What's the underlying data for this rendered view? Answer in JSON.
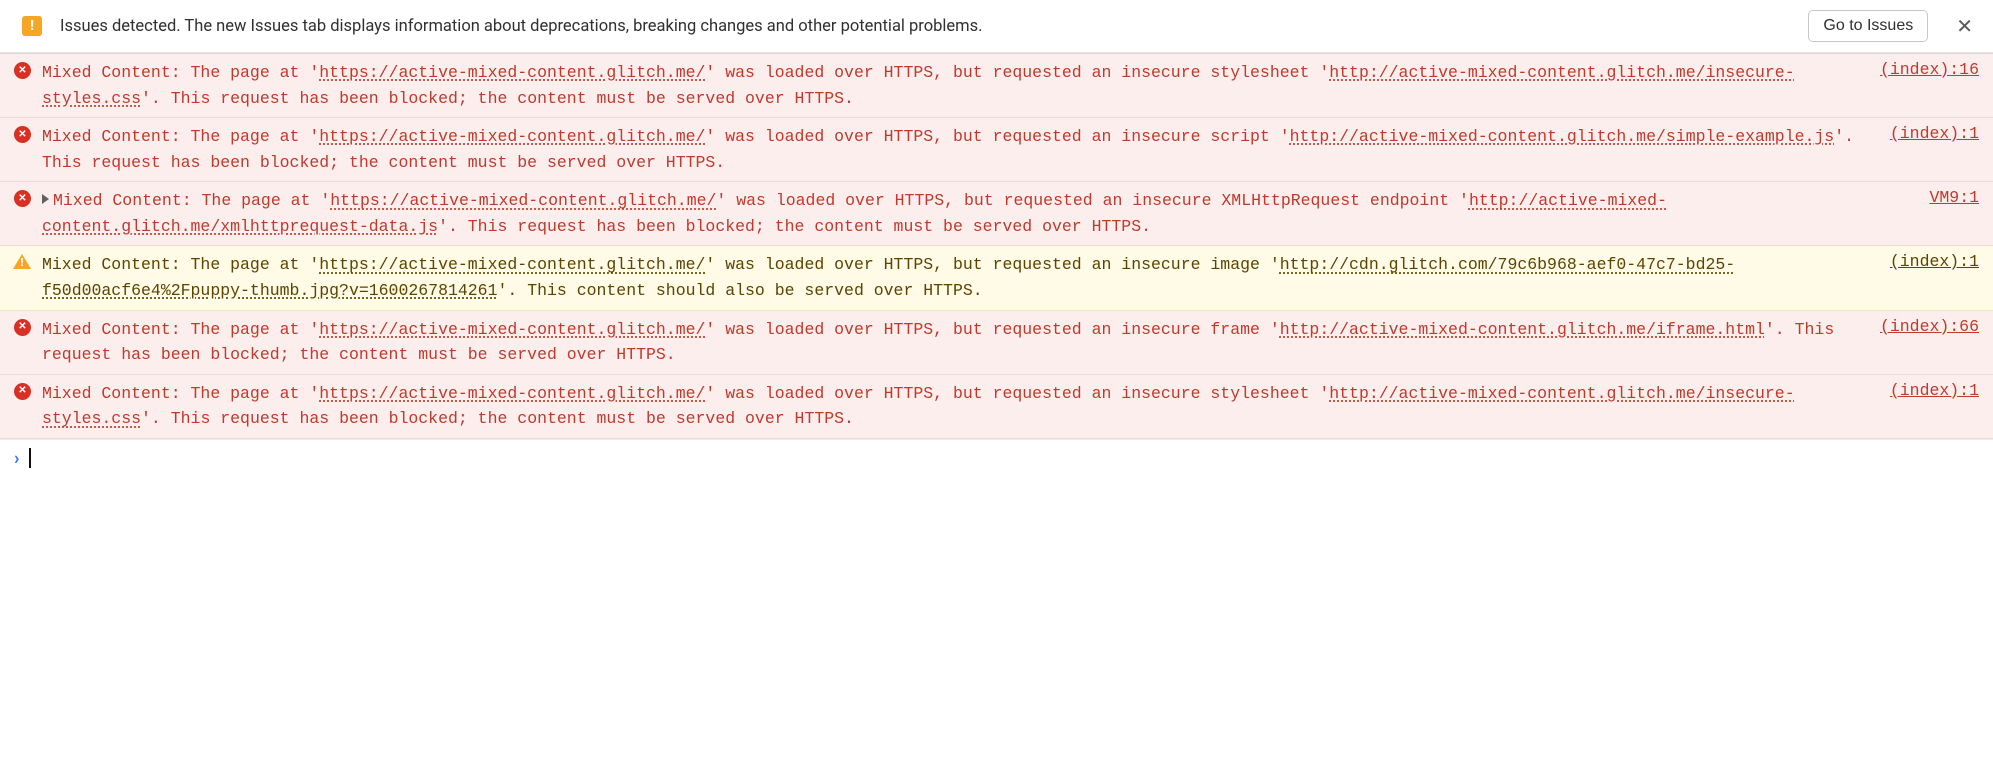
{
  "infobar": {
    "text": "Issues detected. The new Issues tab displays information about deprecations, breaking changes and other potential problems.",
    "button": "Go to Issues"
  },
  "messages": [
    {
      "level": "error",
      "expandable": false,
      "seg1": "Mixed Content: The page at '",
      "url1": "https://active-mixed-content.glitch.me/",
      "seg2": "' was loaded over HTTPS, but requested an insecure stylesheet '",
      "url2": "http://active-mixed-content.glitch.me/insecure-styles.css",
      "seg3": "'. This request has been blocked; the content must be served over HTTPS.",
      "source": "(index):16"
    },
    {
      "level": "error",
      "expandable": false,
      "seg1": "Mixed Content: The page at '",
      "url1": "https://active-mixed-content.glitch.me/",
      "seg2": "' was loaded over HTTPS, but requested an insecure script '",
      "url2": "http://active-mixed-content.glitch.me/simple-example.js",
      "seg3": "'. This request has been blocked; the content must be served over HTTPS.",
      "source": "(index):1"
    },
    {
      "level": "error",
      "expandable": true,
      "seg1": "Mixed Content: The page at '",
      "url1": "https://active-mixed-content.glitch.me/",
      "seg2": "' was loaded over HTTPS, but requested an insecure XMLHttpRequest endpoint '",
      "url2": "http://active-mixed-content.glitch.me/xmlhttprequest-data.js",
      "seg3": "'. This request has been blocked; the content must be served over HTTPS.",
      "source": "VM9:1"
    },
    {
      "level": "warn",
      "expandable": false,
      "seg1": "Mixed Content: The page at '",
      "url1": "https://active-mixed-content.glitch.me/",
      "seg2": "' was loaded over HTTPS, but requested an insecure image '",
      "url2": "http://cdn.glitch.com/79c6b968-aef0-47c7-bd25-f50d00acf6e4%2Fpuppy-thumb.jpg?v=1600267814261",
      "seg3": "'. This content should also be served over HTTPS.",
      "source": "(index):1"
    },
    {
      "level": "error",
      "expandable": false,
      "seg1": "Mixed Content: The page at '",
      "url1": "https://active-mixed-content.glitch.me/",
      "seg2": "' was loaded over HTTPS, but requested an insecure frame '",
      "url2": "http://active-mixed-content.glitch.me/iframe.html",
      "seg3": "'. This request has been blocked; the content must be served over HTTPS.",
      "source": "(index):66"
    },
    {
      "level": "error",
      "expandable": false,
      "seg1": "Mixed Content: The page at '",
      "url1": "https://active-mixed-content.glitch.me/",
      "seg2": "' was loaded over HTTPS, but requested an insecure stylesheet '",
      "url2": "http://active-mixed-content.glitch.me/insecure-styles.css",
      "seg3": "'. This request has been blocked; the content must be served over HTTPS.",
      "source": "(index):1"
    }
  ]
}
